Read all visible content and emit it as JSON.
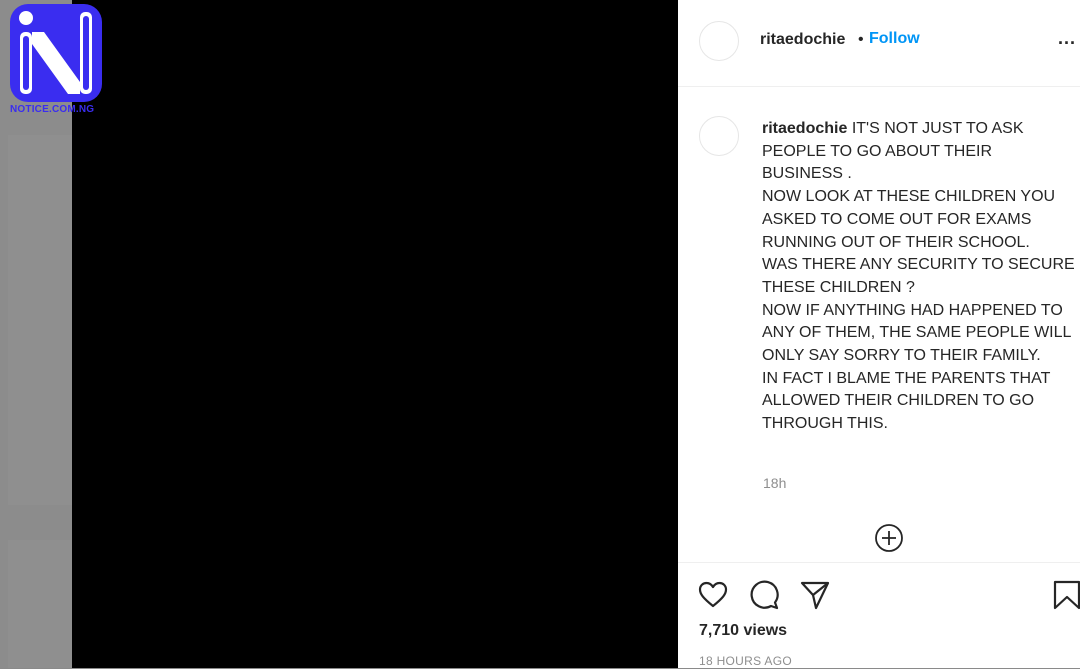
{
  "watermark": {
    "text": "NOTICE.COM.NG",
    "color": "#3a2df0"
  },
  "header": {
    "username": "ritaedochie",
    "separator": "•",
    "follow_label": "Follow",
    "more_label": "..."
  },
  "comment": {
    "username": "ritaedochie",
    "text": "IT'S NOT JUST TO ASK PEOPLE TO GO ABOUT THEIR BUSINESS .\nNOW LOOK AT THESE CHILDREN YOU ASKED TO COME OUT FOR EXAMS RUNNING OUT OF THEIR SCHOOL.\nWAS THERE ANY SECURITY TO SECURE THESE CHILDREN ?\nNOW IF ANYTHING HAD HAPPENED TO ANY OF THEM, THE SAME PEOPLE WILL ONLY SAY SORRY TO THEIR FAMILY.\nIN FACT I BLAME THE PARENTS THAT ALLOWED THEIR CHILDREN TO GO THROUGH THIS.",
    "time": "18h"
  },
  "stats": {
    "views": "7,710 views",
    "posted": "18 HOURS AGO"
  },
  "icons": {
    "like": "heart-icon",
    "comment": "comment-bubble-icon",
    "share": "paper-plane-icon",
    "save": "bookmark-icon",
    "load_more": "plus-circle-icon"
  },
  "colors": {
    "follow": "#0095f6",
    "text": "#262626",
    "muted": "#8e8e8e"
  }
}
